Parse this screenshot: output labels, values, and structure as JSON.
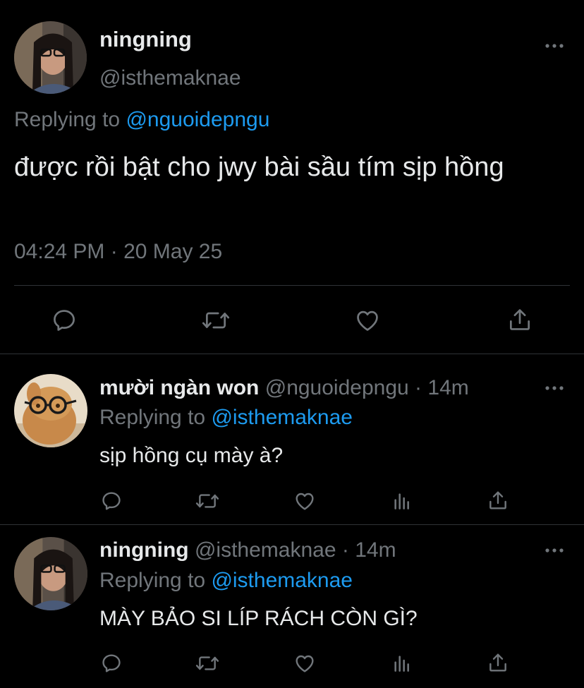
{
  "main_tweet": {
    "author_name": "ningning",
    "author_handle": "@isthemaknae",
    "replying_prefix": "Replying to",
    "replying_to": "@nguoidepngu",
    "text": "được rồi bật cho jwy bài sầu tím sịp hồng",
    "timestamp": "04:24 PM · 20 May 25",
    "actions": [
      "reply-icon",
      "retweet-icon",
      "like-icon",
      "share-icon"
    ]
  },
  "replies": [
    {
      "author_name": "mười ngàn won",
      "author_handle": "@nguoidepngu",
      "separator": "·",
      "time": "14m",
      "replying_prefix": "Replying to",
      "replying_to": "@isthemaknae",
      "text": "sịp hồng cụ mày à?",
      "actions": [
        "reply-icon",
        "retweet-icon",
        "like-icon",
        "analytics-icon",
        "share-icon"
      ]
    },
    {
      "author_name": "ningning",
      "author_handle": "@isthemaknae",
      "separator": "·",
      "time": "14m",
      "replying_prefix": "Replying to",
      "replying_to": "@isthemaknae",
      "text": "MÀY BẢO SI LÍP RÁCH CÒN GÌ?",
      "actions": [
        "reply-icon",
        "retweet-icon",
        "like-icon",
        "analytics-icon",
        "share-icon"
      ]
    }
  ],
  "colors": {
    "background": "#000000",
    "text": "#e7e9ea",
    "muted": "#71767b",
    "link": "#1d9bf0",
    "divider": "#2f3336"
  }
}
